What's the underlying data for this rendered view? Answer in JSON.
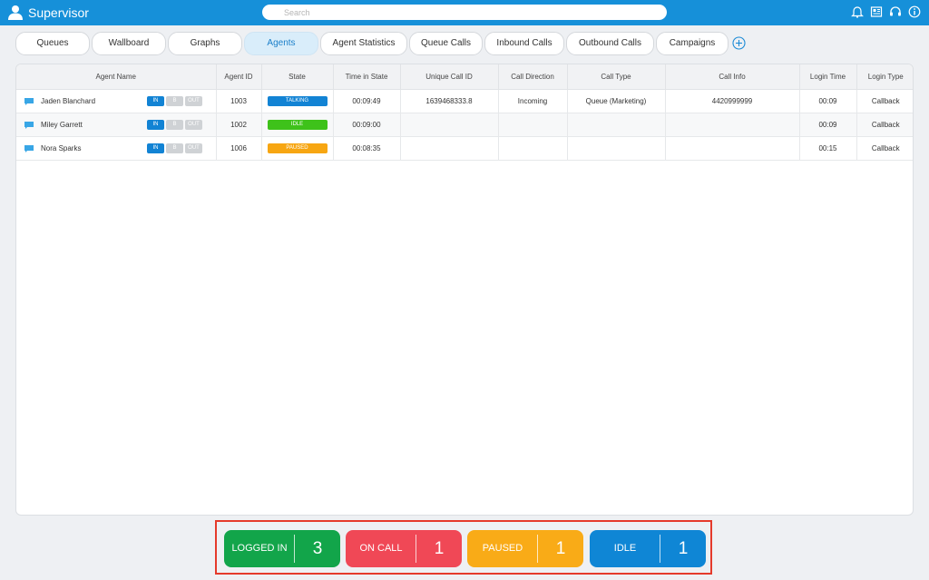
{
  "app": {
    "title": "Supervisor"
  },
  "search": {
    "placeholder": "Search"
  },
  "tabs": [
    {
      "label": "Queues"
    },
    {
      "label": "Wallboard"
    },
    {
      "label": "Graphs"
    },
    {
      "label": "Agents",
      "active": true
    },
    {
      "label": "Agent Statistics"
    },
    {
      "label": "Queue Calls"
    },
    {
      "label": "Inbound Calls"
    },
    {
      "label": "Outbound Calls"
    },
    {
      "label": "Campaigns"
    }
  ],
  "table": {
    "columns": [
      "Agent Name",
      "Agent ID",
      "State",
      "Time in State",
      "Unique Call ID",
      "Call Direction",
      "Call Type",
      "Call Info",
      "Login Time",
      "Login Type"
    ],
    "state_buttons": [
      "IN",
      "B",
      "OUT"
    ],
    "rows": [
      {
        "name": "Jaden Blanchard",
        "agent_id": "1003",
        "state": "TALKING",
        "time_in_state": "00:09:49",
        "unique_call_id": "1639468333.8",
        "call_direction": "Incoming",
        "call_type": "Queue (Marketing)",
        "call_info": "4420999999",
        "login_time": "00:09",
        "login_type": "Callback"
      },
      {
        "name": "Miley Garrett",
        "agent_id": "1002",
        "state": "IDLE",
        "time_in_state": "00:09:00",
        "unique_call_id": "",
        "call_direction": "",
        "call_type": "",
        "call_info": "",
        "login_time": "00:09",
        "login_type": "Callback"
      },
      {
        "name": "Nora Sparks",
        "agent_id": "1006",
        "state": "PAUSED",
        "time_in_state": "00:08:35",
        "unique_call_id": "",
        "call_direction": "",
        "call_type": "",
        "call_info": "",
        "login_time": "00:15",
        "login_type": "Callback"
      }
    ]
  },
  "state_colors": {
    "TALKING": "#1283d4",
    "IDLE": "#3ec21a",
    "PAUSED": "#f7a612"
  },
  "summary": [
    {
      "label": "LOGGED IN",
      "count": "3",
      "color": "#12a54a"
    },
    {
      "label": "ON CALL",
      "count": "1",
      "color": "#f04856"
    },
    {
      "label": "PAUSED",
      "count": "1",
      "color": "#f9ab17"
    },
    {
      "label": "IDLE",
      "count": "1",
      "color": "#0f86d5"
    }
  ],
  "colors": {
    "header": "#1690d9",
    "highlight": "#e53a2b"
  }
}
